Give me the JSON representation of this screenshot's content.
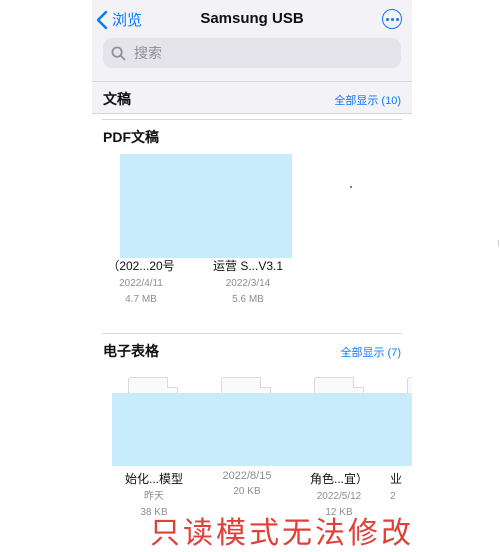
{
  "nav": {
    "back_label": "浏览",
    "title": "Samsung USB"
  },
  "search": {
    "placeholder": "搜索"
  },
  "sections": {
    "documents": {
      "title": "文稿",
      "show_all": "全部显示 (10)"
    },
    "pdf": {
      "title": "PDF文稿",
      "files": [
        {
          "name": "（202...20号",
          "date": "2022/4/11",
          "size": "4.7 MB"
        },
        {
          "name": "运营 S...V3.1",
          "date": "2022/3/14",
          "size": "5.6 MB"
        }
      ]
    },
    "spreadsheets": {
      "title": "电子表格",
      "show_all": "全部显示 (7)",
      "files": [
        {
          "name": "始化...模型",
          "date": "昨天",
          "size": "38 KB"
        },
        {
          "name": "2022/8/15",
          "date": "20 KB",
          "size": ""
        },
        {
          "name": "角色...宜）",
          "date": "2022/5/12",
          "size": "12 KB"
        },
        {
          "name": "业",
          "date": "2",
          "size": ""
        }
      ]
    }
  },
  "watermark": "只读模式无法修改",
  "colors": {
    "accent": "#0a7aff",
    "redaction": "#c9ecfd",
    "watermark": "#e04038"
  }
}
